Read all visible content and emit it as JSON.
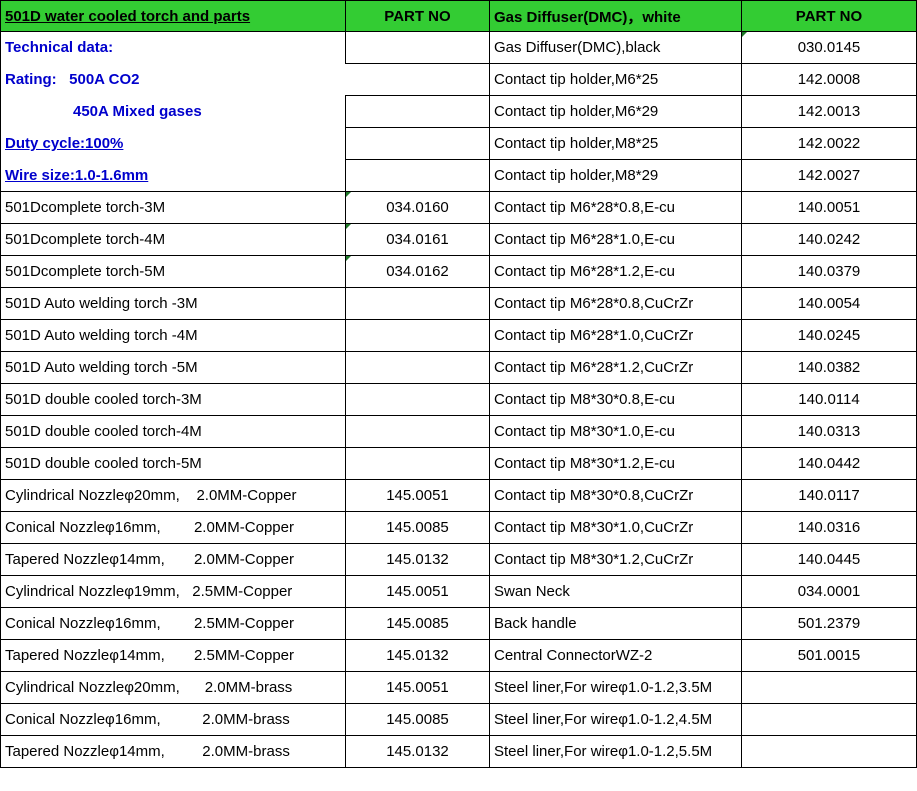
{
  "header": {
    "col1": "501D water cooled torch and parts",
    "col2": "PART NO",
    "col3": "Gas Diffuser(DMC)，white",
    "col4": "PART NO"
  },
  "tech": {
    "title": "Technical data:",
    "rating": "Rating:   500A CO2",
    "rating2": "450A Mixed gases",
    "duty": "Duty cycle:100%",
    "wire": "Wire size:1.0-1.6mm"
  },
  "right_top": [
    {
      "name": "Gas Diffuser(DMC),black",
      "part": "030.0145"
    },
    {
      "name": "Contact tip holder,M6*25",
      "part": "142.0008"
    },
    {
      "name": "Contact tip holder,M6*29",
      "part": "142.0013"
    },
    {
      "name": "Contact tip holder,M8*25",
      "part": "142.0022"
    },
    {
      "name": "Contact tip holder,M8*29",
      "part": "142.0027"
    }
  ],
  "rows": [
    {
      "left": "501Dcomplete torch-3M",
      "left_part": "034.0160",
      "right": "Contact tip M6*28*0.8,E-cu",
      "right_part": "140.0051"
    },
    {
      "left": "501Dcomplete torch-4M",
      "left_part": "034.0161",
      "right": "Contact tip M6*28*1.0,E-cu",
      "right_part": "140.0242"
    },
    {
      "left": "501Dcomplete torch-5M",
      "left_part": "034.0162",
      "right": "Contact tip M6*28*1.2,E-cu",
      "right_part": "140.0379"
    },
    {
      "left": "501D Auto welding torch -3M",
      "left_part": "",
      "right": "Contact tip M6*28*0.8,CuCrZr",
      "right_part": "140.0054"
    },
    {
      "left": "501D Auto welding torch -4M",
      "left_part": "",
      "right": "Contact tip M6*28*1.0,CuCrZr",
      "right_part": "140.0245"
    },
    {
      "left": "501D Auto welding torch -5M",
      "left_part": "",
      "right": "Contact tip M6*28*1.2,CuCrZr",
      "right_part": "140.0382"
    },
    {
      "left": "501D double cooled torch-3M",
      "left_part": "",
      "right": "Contact tip M8*30*0.8,E-cu",
      "right_part": "140.0114"
    },
    {
      "left": "501D double cooled torch-4M",
      "left_part": "",
      "right": "Contact tip M8*30*1.0,E-cu",
      "right_part": "140.0313"
    },
    {
      "left": "501D double cooled torch-5M",
      "left_part": "",
      "right": "Contact tip M8*30*1.2,E-cu",
      "right_part": "140.0442"
    },
    {
      "left": "Cylindrical Nozzleφ20mm,    2.0MM-Copper",
      "left_part": "145.0051",
      "right": "Contact tip M8*30*0.8,CuCrZr",
      "right_part": "140.0117"
    },
    {
      "left": "Conical Nozzleφ16mm,        2.0MM-Copper",
      "left_part": "145.0085",
      "right": "Contact tip M8*30*1.0,CuCrZr",
      "right_part": "140.0316"
    },
    {
      "left": "Tapered Nozzleφ14mm,       2.0MM-Copper",
      "left_part": "145.0132",
      "right": "Contact tip M8*30*1.2,CuCrZr",
      "right_part": "140.0445"
    },
    {
      "left": "Cylindrical Nozzleφ19mm,   2.5MM-Copper",
      "left_part": "145.0051",
      "right": "Swan Neck",
      "right_part": "034.0001"
    },
    {
      "left": "Conical Nozzleφ16mm,        2.5MM-Copper",
      "left_part": "145.0085",
      "right": "Back handle",
      "right_part": "501.2379"
    },
    {
      "left": "Tapered Nozzleφ14mm,       2.5MM-Copper",
      "left_part": "145.0132",
      "right": "Central ConnectorWZ-2",
      "right_part": "501.0015"
    },
    {
      "left": "Cylindrical Nozzleφ20mm,      2.0MM-brass",
      "left_part": "145.0051",
      "right": "Steel liner,For wireφ1.0-1.2,3.5M",
      "right_part": ""
    },
    {
      "left": "Conical Nozzleφ16mm,          2.0MM-brass",
      "left_part": "145.0085",
      "right": "Steel liner,For wireφ1.0-1.2,4.5M",
      "right_part": ""
    },
    {
      "left": "Tapered Nozzleφ14mm,         2.0MM-brass",
      "left_part": "145.0132",
      "right": "Steel liner,For wireφ1.0-1.2,5.5M",
      "right_part": ""
    }
  ]
}
